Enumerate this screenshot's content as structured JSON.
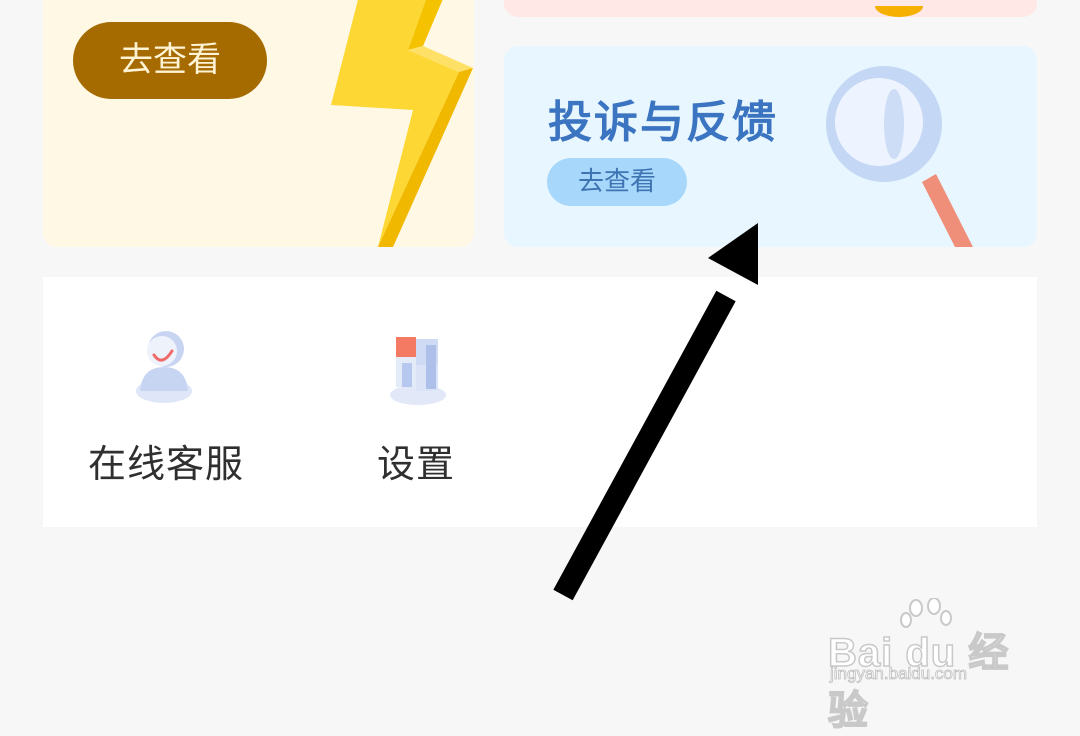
{
  "cards": {
    "left": {
      "button_label": "去查看"
    },
    "feedback": {
      "title": "投诉与反馈",
      "button_label": "去查看"
    }
  },
  "tools": [
    {
      "label": "在线客服",
      "icon": "customer-service-icon"
    },
    {
      "label": "设置",
      "icon": "settings-icon"
    }
  ],
  "watermark": {
    "main": "Bai du 经验",
    "sub": "jingyan.baidu.com"
  },
  "colors": {
    "page_bg": "#f7f7f7",
    "left_card_bg": "#fff8e5",
    "feedback_card_bg": "#e8f6ff",
    "dark_button": "#a56a00",
    "feedback_title": "#3b74c0",
    "arrow": "#000000"
  }
}
